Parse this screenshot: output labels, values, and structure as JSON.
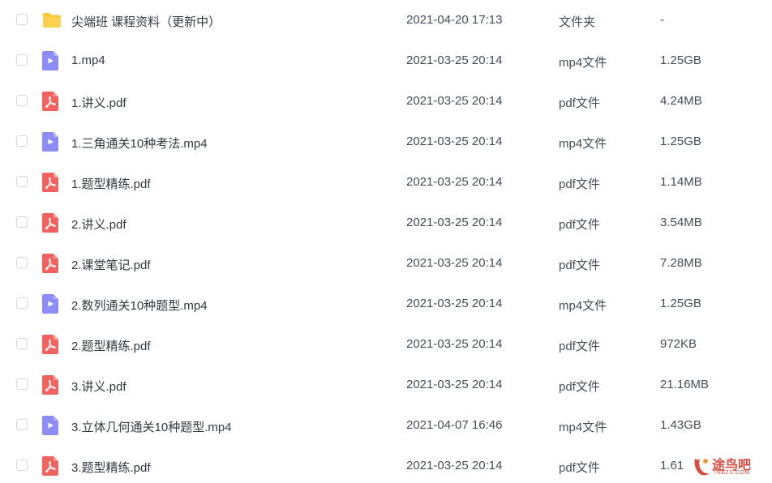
{
  "files": [
    {
      "icon": "folder-icon",
      "name": "尖端班 课程资料（更新中）",
      "date": "2021-04-20 17:13",
      "type": "文件夹",
      "size": "-"
    },
    {
      "icon": "video-file-icon",
      "name": "1.mp4",
      "date": "2021-03-25 20:14",
      "type": "mp4文件",
      "size": "1.25GB"
    },
    {
      "icon": "pdf-file-icon",
      "name": "1.讲义.pdf",
      "date": "2021-03-25 20:14",
      "type": "pdf文件",
      "size": "4.24MB"
    },
    {
      "icon": "video-file-icon",
      "name": "1.三角通关10种考法.mp4",
      "date": "2021-03-25 20:14",
      "type": "mp4文件",
      "size": "1.25GB"
    },
    {
      "icon": "pdf-file-icon",
      "name": "1.题型精练.pdf",
      "date": "2021-03-25 20:14",
      "type": "pdf文件",
      "size": "1.14MB"
    },
    {
      "icon": "pdf-file-icon",
      "name": "2.讲义.pdf",
      "date": "2021-03-25 20:14",
      "type": "pdf文件",
      "size": "3.54MB"
    },
    {
      "icon": "pdf-file-icon",
      "name": "2.课堂笔记.pdf",
      "date": "2021-03-25 20:14",
      "type": "pdf文件",
      "size": "7.28MB"
    },
    {
      "icon": "video-file-icon",
      "name": "2.数列通关10种题型.mp4",
      "date": "2021-03-25 20:14",
      "type": "mp4文件",
      "size": "1.25GB"
    },
    {
      "icon": "pdf-file-icon",
      "name": "2.题型精练.pdf",
      "date": "2021-03-25 20:14",
      "type": "pdf文件",
      "size": "972KB"
    },
    {
      "icon": "pdf-file-icon",
      "name": "3.讲义.pdf",
      "date": "2021-03-25 20:14",
      "type": "pdf文件",
      "size": "21.16MB"
    },
    {
      "icon": "video-file-icon",
      "name": "3.立体几何通关10种题型.mp4",
      "date": "2021-04-07 16:46",
      "type": "mp4文件",
      "size": "1.43GB"
    },
    {
      "icon": "pdf-file-icon",
      "name": "3.题型精练.pdf",
      "date": "2021-03-25 20:14",
      "type": "pdf文件",
      "size": "1.61"
    }
  ],
  "watermark": {
    "text": "途鸟吧",
    "subtext": "TNBZS.COM"
  },
  "colors": {
    "folder": "#fcc631",
    "video": "#8b8cf7",
    "pdf": "#f2625e",
    "watermark": "#d94a3d"
  }
}
